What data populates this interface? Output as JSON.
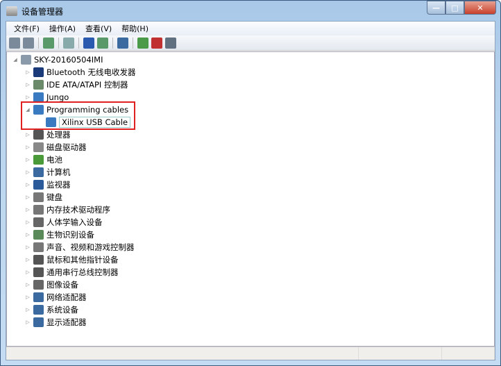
{
  "window": {
    "title": "设备管理器"
  },
  "menu": [
    "文件(F)",
    "操作(A)",
    "查看(V)",
    "帮助(H)"
  ],
  "toolbar": [
    "back-icon",
    "forward-icon",
    "show-hide-tree-icon",
    "properties-icon",
    "help-icon",
    "action-icon",
    "scan-hardware-icon",
    "update-driver-icon",
    "uninstall-icon",
    "disable-icon"
  ],
  "tree": {
    "root": "SKY-20160504IMI",
    "items": [
      {
        "label": "Bluetooth 无线电收发器",
        "icon": "bluetooth-icon",
        "color": "#1a3a7a"
      },
      {
        "label": "IDE ATA/ATAPI 控制器",
        "icon": "ide-controller-icon",
        "color": "#6a8a6a"
      },
      {
        "label": "Jungo",
        "icon": "network-icon",
        "color": "#3a7ac0"
      },
      {
        "label": "Programming cables",
        "icon": "network-icon",
        "color": "#3a7ac0",
        "expanded": true,
        "children": [
          "Xilinx USB Cable"
        ]
      },
      {
        "label": "处理器",
        "icon": "processor-icon",
        "color": "#555"
      },
      {
        "label": "磁盘驱动器",
        "icon": "disk-drive-icon",
        "color": "#888"
      },
      {
        "label": "电池",
        "icon": "battery-icon",
        "color": "#4a9a3a"
      },
      {
        "label": "计算机",
        "icon": "computer-icon",
        "color": "#3a6aa0"
      },
      {
        "label": "监视器",
        "icon": "monitor-icon",
        "color": "#2a5a9a"
      },
      {
        "label": "键盘",
        "icon": "keyboard-icon",
        "color": "#777"
      },
      {
        "label": "内存技术驱动程序",
        "icon": "memory-icon",
        "color": "#777"
      },
      {
        "label": "人体学输入设备",
        "icon": "hid-icon",
        "color": "#666"
      },
      {
        "label": "生物识别设备",
        "icon": "biometric-icon",
        "color": "#5a8a5a"
      },
      {
        "label": "声音、视频和游戏控制器",
        "icon": "sound-icon",
        "color": "#777"
      },
      {
        "label": "鼠标和其他指针设备",
        "icon": "mouse-icon",
        "color": "#555"
      },
      {
        "label": "通用串行总线控制器",
        "icon": "usb-icon",
        "color": "#555"
      },
      {
        "label": "图像设备",
        "icon": "camera-icon",
        "color": "#666"
      },
      {
        "label": "网络适配器",
        "icon": "network-adapter-icon",
        "color": "#3a6aa0"
      },
      {
        "label": "系统设备",
        "icon": "system-device-icon",
        "color": "#3a6aa0"
      },
      {
        "label": "显示适配器",
        "icon": "display-adapter-icon",
        "color": "#3a6aa0"
      }
    ]
  },
  "highlight_color": "#e02020"
}
